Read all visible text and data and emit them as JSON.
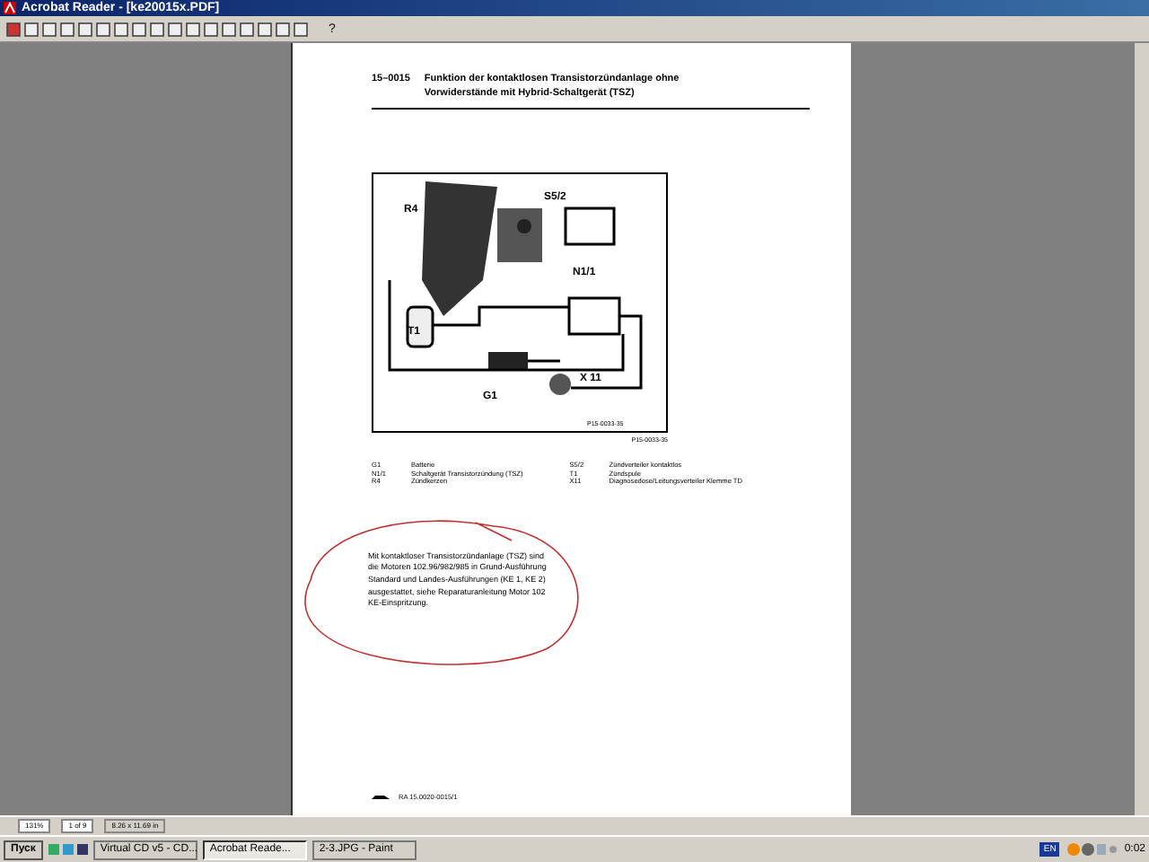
{
  "window": {
    "title": "Acrobat Reader - [ke20015x.PDF]"
  },
  "toolbar": {
    "help_label": "?"
  },
  "page": {
    "section_number": "15–0015",
    "heading_lines": [
      "Funktion der kontaktlosen Transistorzündanlage ohne",
      "Vorwiderstände mit Hybrid-Schaltgerät (TSZ)"
    ],
    "diagram": {
      "labels": [
        "R4",
        "S5/2",
        "N1/1",
        "T1",
        "G1",
        "X 11",
        "P15-0033-35"
      ],
      "caption": "P15-0033-35"
    },
    "legend": [
      {
        "code": "G1",
        "text": "Batterie"
      },
      {
        "code": "N1/1",
        "text": "Schaltgerät Transistorzündung (TSZ)"
      },
      {
        "code": "R4",
        "text": "Zündkerzen"
      },
      {
        "code": "S5/2",
        "text": "Zündverteiler kontaktlos"
      },
      {
        "code": "T1",
        "text": "Zündspule"
      },
      {
        "code": "X11",
        "text": "Diagnosedose/Leitungsverteiler Klemme TD"
      }
    ],
    "note": "Mit kontaktloser Transistorzündanlage (TSZ) sind die Motoren 102.96/982/985 in Grund-Ausführung Standard und Landes-Ausführungen (KE 1, KE 2) ausgestattet, siehe Reparaturanleitung Motor 102 KE-Einspritzung.",
    "footer": "RA 15.0020-0015/1"
  },
  "status_bar": {
    "zoom": "131%",
    "page_counter": "1 of 9",
    "page_size": "8.26 x 11.69 in"
  },
  "taskbar": {
    "start": "Пуск",
    "tasks": [
      {
        "label": "Virtual CD v5 - CD...",
        "selected": false
      },
      {
        "label": "Acrobat Reade...",
        "selected": true
      },
      {
        "label": "2-3.JPG - Paint",
        "selected": false
      }
    ],
    "language": "EN",
    "clock": "0:02"
  }
}
